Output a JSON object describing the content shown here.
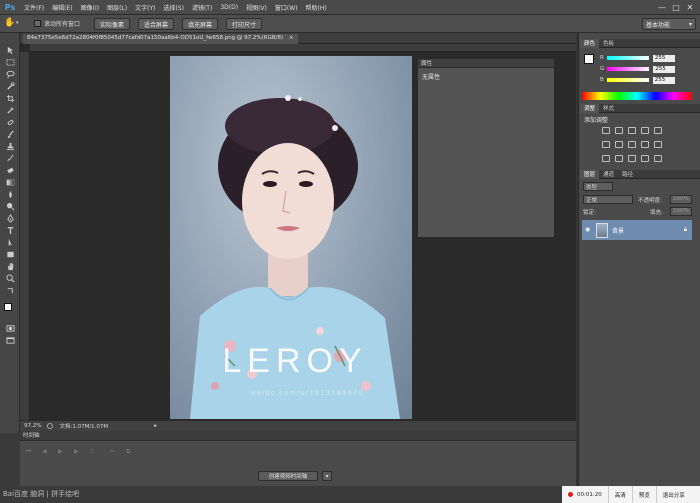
{
  "app": {
    "logo": "Ps",
    "menu": [
      "文件(F)",
      "编辑(E)",
      "图像(I)",
      "图层(L)",
      "文字(Y)",
      "选择(S)",
      "滤镜(T)",
      "3D(D)",
      "视图(V)",
      "窗口(W)",
      "帮助(H)"
    ],
    "window_controls": [
      "—",
      "□",
      "✕"
    ]
  },
  "options_bar": {
    "scroll_all_label": "滚动所有窗口",
    "actual_pixels": "实际像素",
    "fit_screen": "适合屏幕",
    "fill_screen": "填充屏幕",
    "print_size": "打印尺寸",
    "workspace": "基本功能"
  },
  "document": {
    "tab_title": "84e7375e5e6d72a2804f0f85045d77cafd07a150aa6b4-OD51oU_fw658.png @ 97.2%(RGB/8)",
    "close": "×",
    "watermark_main": "LEROY",
    "watermark_sub": "weibo.com/u/1813184870"
  },
  "properties_panel": {
    "title": "属性",
    "empty_text": "无属性"
  },
  "status": {
    "zoom": "97.2%",
    "doc_size": "文档:1.07M/1.07M"
  },
  "timeline": {
    "title": "时间轴",
    "create_button": "创建视频时间轴"
  },
  "color_panel": {
    "tabs": [
      "颜色",
      "色板"
    ],
    "channels": [
      {
        "name": "R",
        "value": "255"
      },
      {
        "name": "G",
        "value": "255"
      },
      {
        "name": "B",
        "value": "255"
      }
    ]
  },
  "adjustments_panel": {
    "tabs": [
      "调整",
      "样式"
    ],
    "title": "添加调整"
  },
  "layers_panel": {
    "tabs": [
      "图层",
      "通道",
      "路径"
    ],
    "kind_filter": "类型",
    "blend_mode": "正常",
    "opacity_label": "不透明度:",
    "opacity_value": "100%",
    "lock_label": "锁定:",
    "fill_label": "填充:",
    "fill_value": "100%",
    "layer_name": "背景"
  },
  "bottom": {
    "baidu_mark": "Bai百度 脑洞 | 拼手绘吧"
  },
  "recorder": {
    "time": "00:01:20",
    "quality": "高清",
    "preview": "预览",
    "exit_share": "退出分享"
  },
  "colors": {
    "accent_blue": "#4aa3df",
    "layer_selected": "#6e8bb0",
    "record_red": "#d91c1c"
  }
}
